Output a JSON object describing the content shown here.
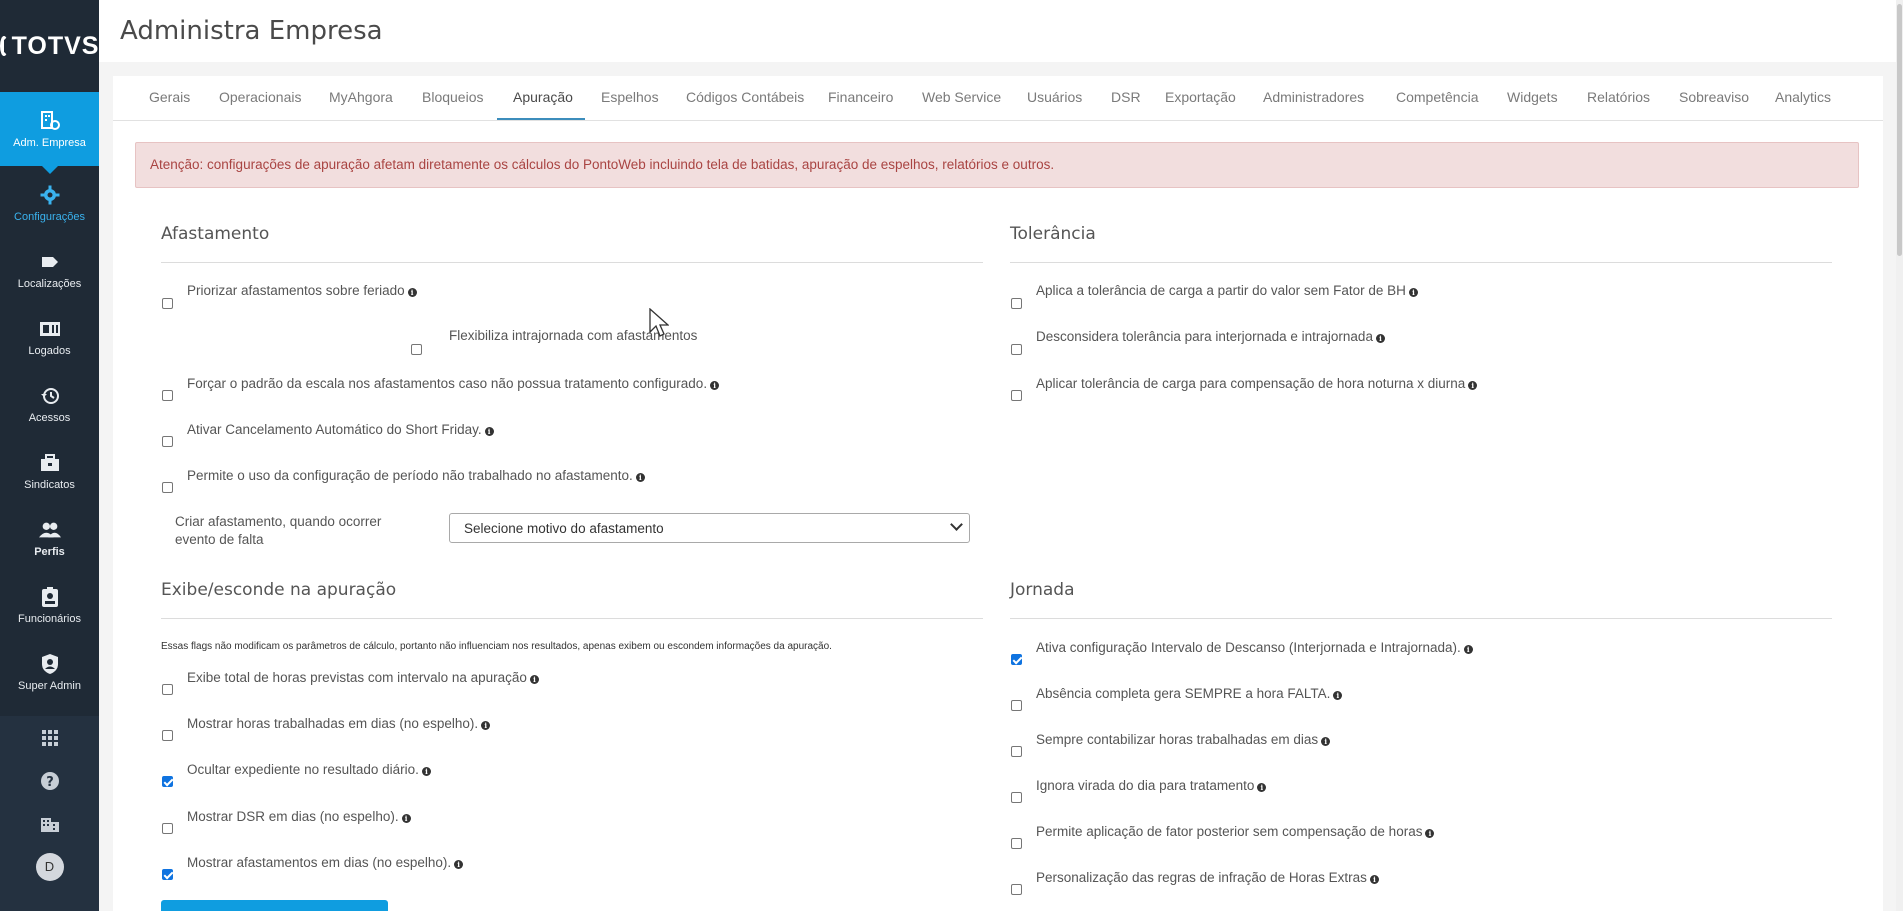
{
  "app": {
    "logo_text": "TOTVS",
    "page_title": "Administra Empresa"
  },
  "sidebar": {
    "items": [
      {
        "label": "Adm. Empresa",
        "icon": "company-settings-icon"
      },
      {
        "label": "Configurações",
        "icon": "gear-icon"
      },
      {
        "label": "Localizações",
        "icon": "tag-icon"
      },
      {
        "label": "Logados",
        "icon": "id-card-icon"
      },
      {
        "label": "Acessos",
        "icon": "history-icon"
      },
      {
        "label": "Sindicatos",
        "icon": "briefcase-icon"
      },
      {
        "label": "Perfis",
        "icon": "users-icon"
      },
      {
        "label": "Funcionários",
        "icon": "badge-icon"
      },
      {
        "label": "Super Admin",
        "icon": "shield-user-icon"
      }
    ],
    "bottom_icons": [
      "apps-grid-icon",
      "help-icon",
      "building-icon"
    ],
    "avatar_initial": "D"
  },
  "tabs": [
    {
      "label": "Gerais"
    },
    {
      "label": "Operacionais"
    },
    {
      "label": "MyAhgora"
    },
    {
      "label": "Bloqueios"
    },
    {
      "label": "Apuração"
    },
    {
      "label": "Espelhos"
    },
    {
      "label": "Códigos Contábeis"
    },
    {
      "label": "Financeiro"
    },
    {
      "label": "Web Service"
    },
    {
      "label": "Usuários"
    },
    {
      "label": "DSR"
    },
    {
      "label": "Exportação"
    },
    {
      "label": "Administradores"
    },
    {
      "label": "Competência"
    },
    {
      "label": "Widgets"
    },
    {
      "label": "Relatórios"
    },
    {
      "label": "Sobreaviso"
    },
    {
      "label": "Analytics"
    }
  ],
  "active_tab": "Apuração",
  "alert": "Atenção: configurações de apuração afetam diretamente os cálculos do PontoWeb incluindo tela de batidas, apuração de espelhos, relatórios e outros.",
  "afastamento": {
    "title": "Afastamento",
    "options": [
      {
        "label": "Priorizar afastamentos sobre feriado",
        "checked": false
      },
      {
        "label": "Flexibiliza intrajornada com afastamentos",
        "checked": false
      },
      {
        "label": "Forçar o padrão da escala nos afastamentos caso não possua tratamento configurado.",
        "checked": false
      },
      {
        "label": "Ativar Cancelamento Automático do Short Friday.",
        "checked": false
      },
      {
        "label": "Permite o uso da configuração de período não trabalhado no afastamento.",
        "checked": false
      }
    ],
    "select_label": "Criar afastamento, quando ocorrer evento de falta",
    "select_value": "Selecione motivo do afastamento"
  },
  "tolerancia": {
    "title": "Tolerância",
    "options": [
      {
        "label": "Aplica a tolerância de carga a partir do valor sem Fator de BH",
        "checked": false
      },
      {
        "label": "Desconsidera tolerância para interjornada e intrajornada",
        "checked": false
      },
      {
        "label": "Aplicar tolerância de carga para compensação de hora noturna x diurna",
        "checked": false
      }
    ]
  },
  "exibe": {
    "title": "Exibe/esconde na apuração",
    "note": "Essas flags não modificam os parâmetros de cálculo, portanto não influenciam nos resultados, apenas exibem ou escondem informações da apuração.",
    "options": [
      {
        "label": "Exibe total de horas previstas com intervalo na apuração",
        "checked": false
      },
      {
        "label": "Mostrar horas trabalhadas em dias (no espelho).",
        "checked": false
      },
      {
        "label": "Ocultar expediente no resultado diário.",
        "checked": true
      },
      {
        "label": "Mostrar DSR em dias (no espelho).",
        "checked": false
      },
      {
        "label": "Mostrar afastamentos em dias (no espelho).",
        "checked": true
      }
    ]
  },
  "jornada": {
    "title": "Jornada",
    "options": [
      {
        "label": "Ativa configuração Intervalo de Descanso (Interjornada e Intrajornada).",
        "checked": true
      },
      {
        "label": "Absência completa gera SEMPRE a hora FALTA.",
        "checked": false
      },
      {
        "label": "Sempre contabilizar horas trabalhadas em dias",
        "checked": false
      },
      {
        "label": "Ignora virada do dia para tratamento",
        "checked": false
      },
      {
        "label": "Permite aplicação de fator posterior sem compensação de horas",
        "checked": false
      },
      {
        "label": "Personalização das regras de infração de Horas Extras",
        "checked": false
      }
    ]
  },
  "colors": {
    "sidebar_bg": "#1f2a36",
    "accent": "#0f9de0",
    "alert_bg": "#f2dede",
    "alert_text": "#a94442"
  }
}
